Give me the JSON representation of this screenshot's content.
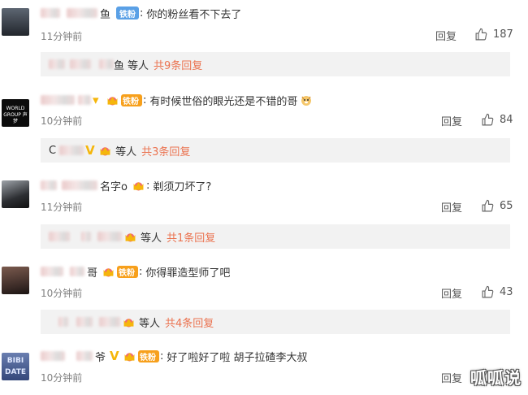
{
  "comments": [
    {
      "name_hint": "鱼",
      "fan_badge": "铁粉",
      "text": "你的粉丝看不下去了",
      "time": "11分钟前",
      "reply_label": "回复",
      "likes": "187",
      "sub": {
        "name_hint": "鱼",
        "etc": "等人",
        "more": "共9条回复"
      }
    },
    {
      "fan_badge": "铁粉",
      "text": "有时候世俗的眼光还是不错的哥",
      "time": "10分钟前",
      "reply_label": "回复",
      "likes": "84",
      "avatar_text": "WORLD GROUP 声梦",
      "sub": {
        "name_hint": "C",
        "etc": "等人",
        "more": "共3条回复"
      }
    },
    {
      "name_hint": "名字o",
      "text": "剃须刀坏了?",
      "time": "11分钟前",
      "reply_label": "回复",
      "likes": "65",
      "sub": {
        "etc": "等人",
        "more": "共1条回复"
      }
    },
    {
      "name_hint": "哥",
      "fan_badge": "铁粉",
      "text": "你得罪造型师了吧",
      "time": "10分钟前",
      "reply_label": "回复",
      "likes": "43",
      "sub": {
        "etc": "等人",
        "more": "共4条回复"
      }
    },
    {
      "name_hint": "爷",
      "fan_badge": "铁粉",
      "text": "好了啦好了啦 胡子拉碴李大叔",
      "time": "10分钟前",
      "reply_label": "回复",
      "likes": "",
      "avatar_text": "BIBI DATE"
    }
  ],
  "watermark": "呱呱说",
  "colors": {
    "accent_more": "#eb7350",
    "fan_badge": "#5aa0e6",
    "gold_badge": "#f7a01c"
  }
}
